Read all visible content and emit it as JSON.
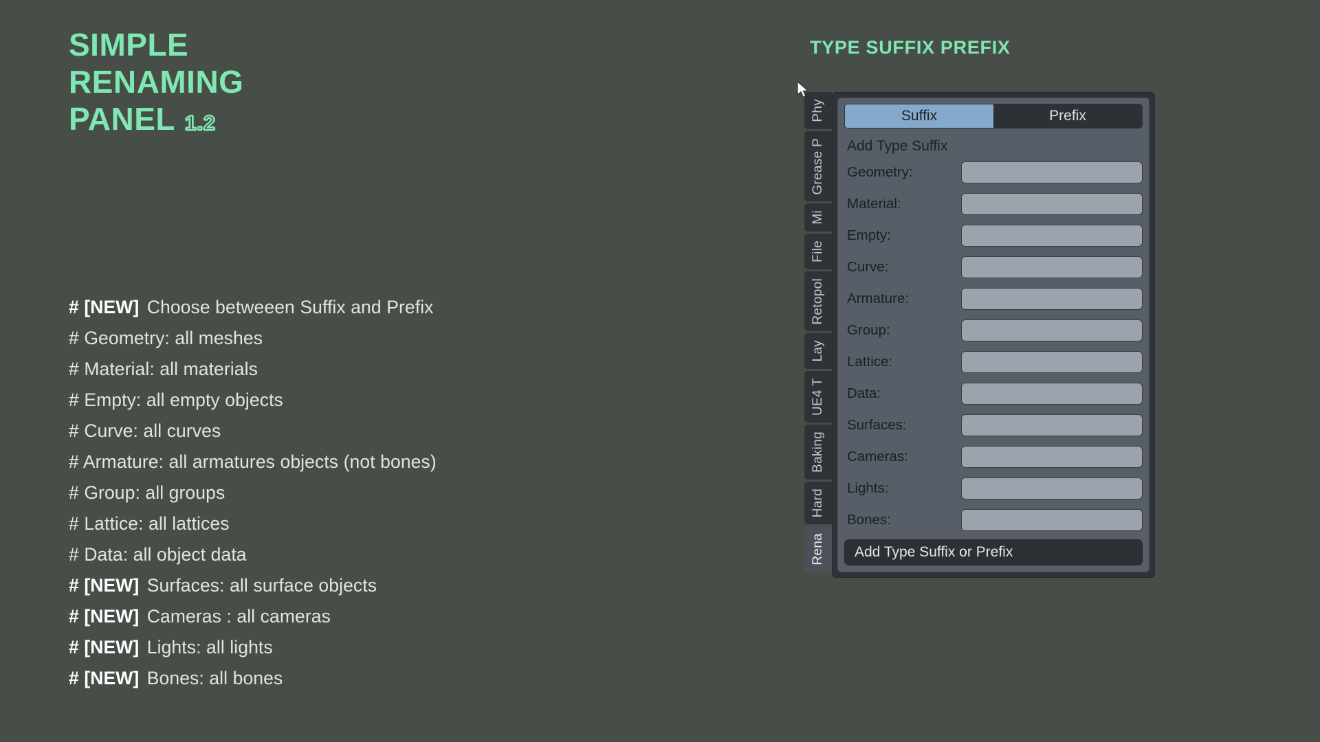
{
  "background_color": "#474e48",
  "accent_color": "#7fe8b2",
  "hero": {
    "title_line1": "SIMPLE",
    "title_line2": "RENAMING",
    "title_line3": "PANEL",
    "version": "1.2"
  },
  "features": [
    {
      "hash": "#",
      "new_tag": "[NEW]",
      "text": "Choose betweeen Suffix and Prefix",
      "is_new": true
    },
    {
      "hash": "#",
      "new_tag": "",
      "text": "Geometry: all meshes",
      "is_new": false
    },
    {
      "hash": "#",
      "new_tag": "",
      "text": "Material: all materials",
      "is_new": false
    },
    {
      "hash": "#",
      "new_tag": "",
      "text": "Empty: all empty objects",
      "is_new": false
    },
    {
      "hash": "#",
      "new_tag": "",
      "text": "Curve: all curves",
      "is_new": false
    },
    {
      "hash": "#",
      "new_tag": "",
      "text": "Armature: all armatures objects (not bones)",
      "is_new": false
    },
    {
      "hash": "#",
      "new_tag": "",
      "text": "Group: all groups",
      "is_new": false
    },
    {
      "hash": "#",
      "new_tag": "",
      "text": "Lattice: all lattices",
      "is_new": false
    },
    {
      "hash": "#",
      "new_tag": "",
      "text": "Data: all object data",
      "is_new": false
    },
    {
      "hash": "#",
      "new_tag": "[NEW]",
      "text": "Surfaces: all surface objects",
      "is_new": true
    },
    {
      "hash": "#",
      "new_tag": "[NEW]",
      "text": "Cameras : all cameras",
      "is_new": true
    },
    {
      "hash": "#",
      "new_tag": "[NEW]",
      "text": "Lights: all lights",
      "is_new": true
    },
    {
      "hash": "#",
      "new_tag": "[NEW]",
      "text": "Bones: all bones",
      "is_new": true
    }
  ],
  "panel": {
    "heading": "TYPE SUFFIX PREFIX",
    "tabs": [
      {
        "label": "Phy",
        "active": false
      },
      {
        "label": "Grease P",
        "active": false
      },
      {
        "label": "Mi",
        "active": false
      },
      {
        "label": "File",
        "active": false
      },
      {
        "label": "Retopol",
        "active": false
      },
      {
        "label": "Lay",
        "active": false
      },
      {
        "label": "UE4 T",
        "active": false
      },
      {
        "label": "Baking",
        "active": false
      },
      {
        "label": "Hard",
        "active": false
      },
      {
        "label": "Rena",
        "active": true
      }
    ],
    "mode_toggle": {
      "suffix_label": "Suffix",
      "prefix_label": "Prefix",
      "selected": "Suffix",
      "active_color": "#85a8cd",
      "inactive_color": "#2d3035"
    },
    "section_label": "Add Type Suffix",
    "fields": [
      {
        "label": "Geometry:",
        "value": ""
      },
      {
        "label": "Material:",
        "value": ""
      },
      {
        "label": "Empty:",
        "value": ""
      },
      {
        "label": "Curve:",
        "value": ""
      },
      {
        "label": "Armature:",
        "value": ""
      },
      {
        "label": "Group:",
        "value": ""
      },
      {
        "label": "Lattice:",
        "value": ""
      },
      {
        "label": "Data:",
        "value": ""
      },
      {
        "label": "Surfaces:",
        "value": ""
      },
      {
        "label": "Cameras:",
        "value": ""
      },
      {
        "label": "Lights:",
        "value": ""
      },
      {
        "label": "Bones:",
        "value": ""
      }
    ],
    "action_button": "Add Type Suffix or Prefix"
  }
}
